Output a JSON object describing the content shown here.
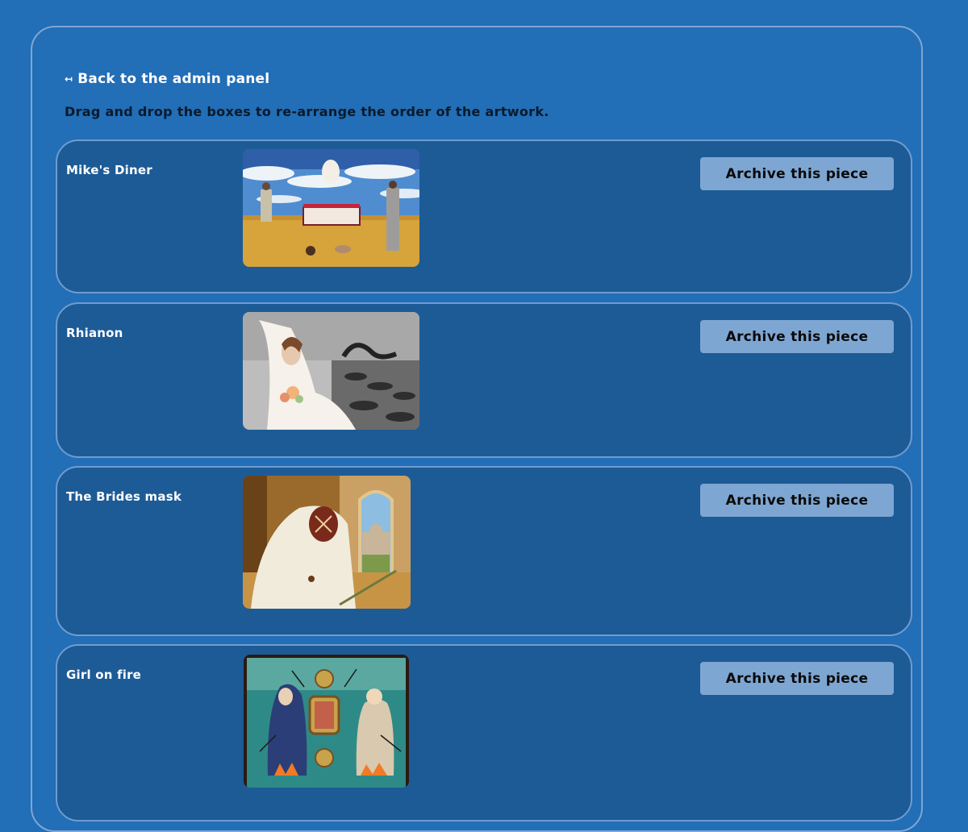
{
  "back_link": {
    "arrow": "↤",
    "label": "Back to the admin panel"
  },
  "instructions": "Drag and drop the boxes to re-arrange the order of the artwork.",
  "artworks": [
    {
      "title": "Mike's Diner",
      "button": "Archive this piece"
    },
    {
      "title": "Rhianon",
      "button": "Archive this piece"
    },
    {
      "title": "The Brides mask",
      "button": "Archive this piece"
    },
    {
      "title": "Girl on fire",
      "button": "Archive this piece"
    }
  ],
  "colors": {
    "page_bg": "#226eb7",
    "card_bg": "#1d5b96",
    "card_border": "#6f9cd0",
    "button_bg": "#7ea6d2"
  }
}
